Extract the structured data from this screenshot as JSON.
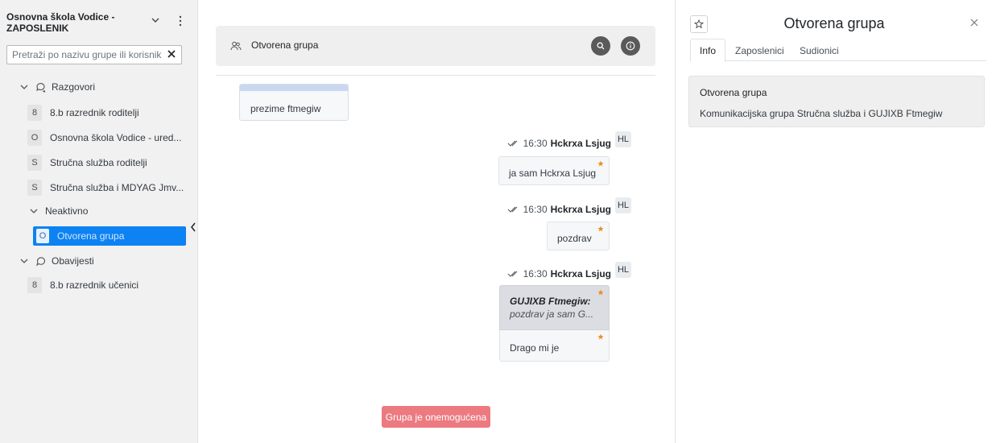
{
  "sidebar": {
    "org_title": "Osnovna škola Vodice - ZAPOSLENIK",
    "search_placeholder": "Pretraži po nazivu grupe ili korisnik",
    "sections": {
      "razgovori": "Razgovori",
      "neaktivno": "Neaktivno",
      "obavijesti": "Obavijesti"
    },
    "razgovori_items": [
      {
        "badge": "8",
        "label": "8.b razrednik roditelji"
      },
      {
        "badge": "O",
        "label": "Osnovna škola Vodice - ured..."
      },
      {
        "badge": "S",
        "label": "Stručna služba roditelji"
      },
      {
        "badge": "S",
        "label": "Stručna služba i MDYAG Jmv..."
      }
    ],
    "neaktivno_items": [
      {
        "badge": "O",
        "label": "Otvorena grupa"
      }
    ],
    "obavijesti_items": [
      {
        "badge": "8",
        "label": "8.b razrednik učenici"
      }
    ]
  },
  "chat": {
    "header_title": "Otvorena grupa",
    "messages": {
      "incoming": {
        "text": "prezime ftmegiw"
      },
      "m1": {
        "time": "16:30",
        "author": "Hckrxa Lsjug",
        "avatar": "HL",
        "text": "ja sam Hckrxa Lsjug"
      },
      "m2": {
        "time": "16:30",
        "author": "Hckrxa Lsjug",
        "avatar": "HL",
        "text": "pozdrav"
      },
      "m3": {
        "time": "16:30",
        "author": "Hckrxa Lsjug",
        "avatar": "HL",
        "quote_author": "GUJIXB Ftmegiw:",
        "quote_text": "pozdrav ja sam G...",
        "text": "Drago mi je"
      }
    },
    "disabled_label": "Grupa je onemogućena"
  },
  "info": {
    "title": "Otvorena grupa",
    "tabs": [
      "Info",
      "Zaposlenici",
      "Sudionici"
    ],
    "card_title": "Otvorena grupa",
    "card_text": "Komunikacijska grupa Stručna služba i GUJIXB Ftmegiw"
  },
  "colors": {
    "accent": "#0d82f2",
    "disabled": "#ec7a80",
    "star": "#f08a24",
    "icon_buttons": "#5a5a5a"
  },
  "icons": [
    "chevron-down-icon",
    "kebab-menu-icon",
    "clear-icon",
    "chat-bubbles-icon",
    "chat-bubble-icon",
    "users-icon",
    "search-icon",
    "info-icon",
    "double-check-icon",
    "star-icon",
    "close-icon",
    "chevron-left-icon"
  ]
}
